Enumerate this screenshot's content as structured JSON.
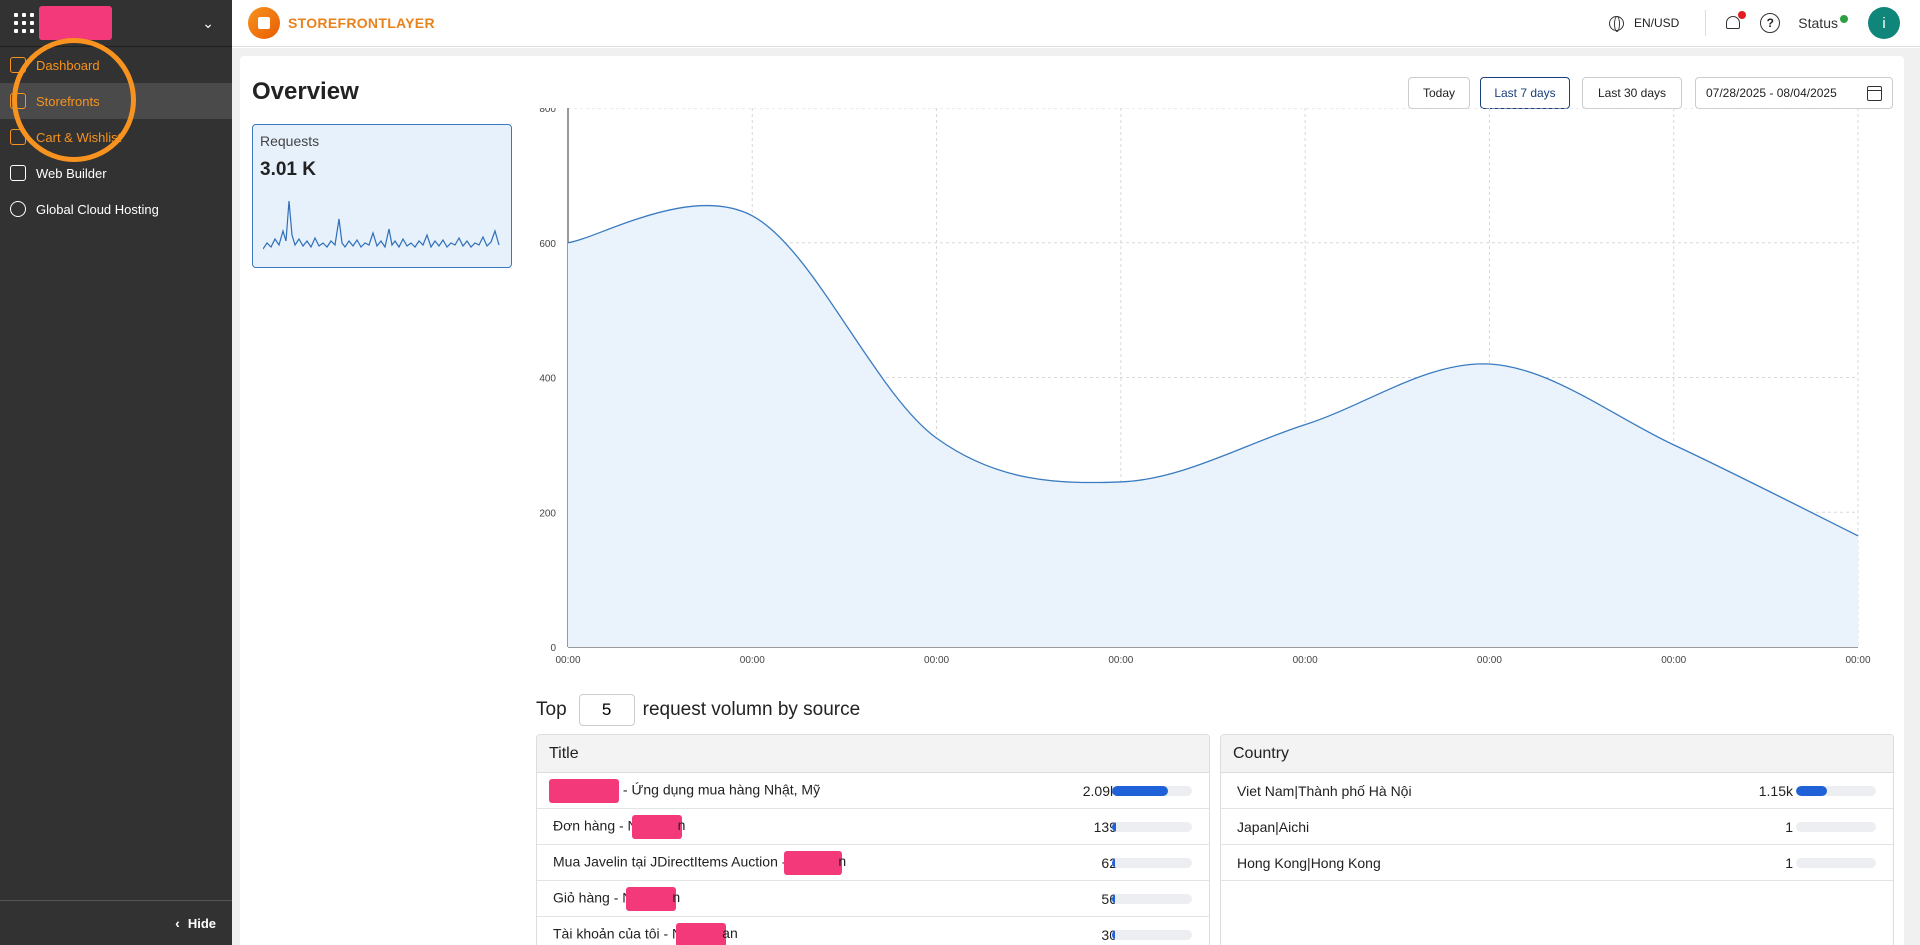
{
  "brand": {
    "name": "STOREFRONTLAYER"
  },
  "sidebar": {
    "items": [
      {
        "label": "Dashboard",
        "icon": "dashboard-icon"
      },
      {
        "label": "Storefronts",
        "icon": "storefront-icon"
      },
      {
        "label": "Cart & Wishlist",
        "icon": "cart-icon"
      },
      {
        "label": "Web Builder",
        "icon": "web-builder-icon"
      },
      {
        "label": "Global Cloud Hosting",
        "icon": "globe-icon"
      }
    ],
    "hide_label": "Hide"
  },
  "header": {
    "lang": "EN/USD",
    "status_label": "Status",
    "avatar_initial": "i"
  },
  "overview": {
    "title": "Overview",
    "range_buttons": [
      "Today",
      "Last 7 days",
      "Last 30 days"
    ],
    "active_range": "Last 7 days",
    "date_range": "07/28/2025 - 08/04/2025"
  },
  "requests_card": {
    "label": "Requests",
    "value": "3.01 K"
  },
  "chart_data": {
    "type": "area",
    "x": [
      "00:00",
      "00:00",
      "00:00",
      "00:00",
      "00:00",
      "00:00",
      "00:00",
      "00:00"
    ],
    "series": [
      {
        "values": [
          600,
          640,
          310,
          245,
          330,
          420,
          300,
          165
        ]
      }
    ],
    "ylim": [
      0,
      800
    ],
    "yticks": [
      0,
      200,
      400,
      600,
      800
    ],
    "grid": true,
    "color": "#3a7bc0"
  },
  "top_sources": {
    "prefix": "Top",
    "count": "5",
    "suffix": "request volumn by source"
  },
  "title_table": {
    "header": "Title",
    "max": 2090,
    "rows": [
      {
        "pre": "",
        "post": " - Ứng dụng mua hàng Nhật, Mỹ",
        "value": "2.09k",
        "num": 2090
      },
      {
        "pre": "Đơn hàng - N",
        "post": "n",
        "value": "139",
        "num": 139
      },
      {
        "pre": "Mua Javelin tại JDirectItems Auction - ",
        "post": "n",
        "value": "62",
        "num": 62
      },
      {
        "pre": "Giỏ hàng - N",
        "post": "n",
        "value": "56",
        "num": 56
      },
      {
        "pre": "Tài khoản của tôi - N",
        "post": "an",
        "value": "30",
        "num": 30
      }
    ]
  },
  "country_table": {
    "header": "Country",
    "max": 3000,
    "rows": [
      {
        "label": "Viet Nam|Thành phố Hà Nội",
        "value": "1.15k",
        "num": 1150
      },
      {
        "label": "Japan|Aichi",
        "value": "1",
        "num": 1
      },
      {
        "label": "Hong Kong|Hong Kong",
        "value": "1",
        "num": 1
      }
    ]
  }
}
